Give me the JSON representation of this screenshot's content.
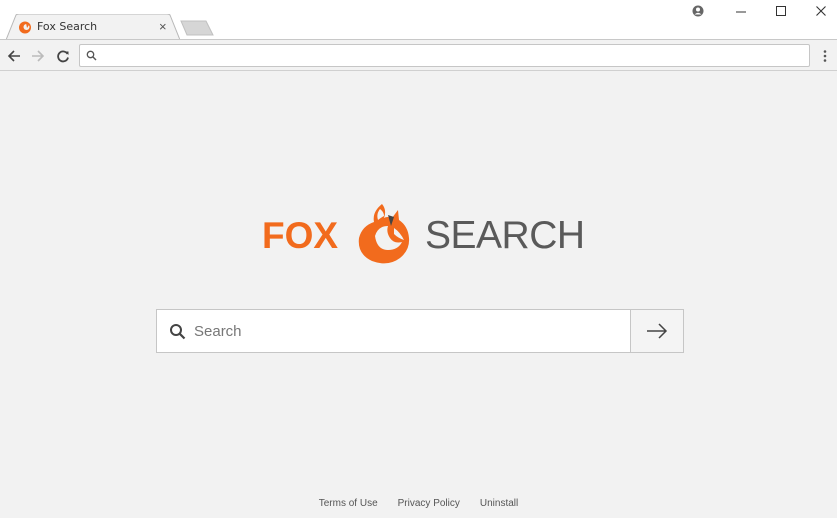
{
  "browser": {
    "tab": {
      "title": "Fox Search",
      "close_glyph": "×"
    },
    "omnibox": {
      "value": "",
      "placeholder": ""
    },
    "icons": [
      "back-arrow-icon",
      "forward-arrow-icon",
      "reload-icon",
      "search-icon",
      "menu-dots-icon",
      "account-icon",
      "minimize-icon",
      "maximize-icon",
      "close-icon"
    ]
  },
  "page": {
    "logo": {
      "word1": "FOX",
      "word2": "SEARCH"
    },
    "search": {
      "placeholder": "Search",
      "value": "",
      "submit_glyph": "→"
    },
    "footer": {
      "links": [
        "Terms of Use",
        "Privacy Policy",
        "Uninstall"
      ]
    },
    "colors": {
      "brand_orange": "#f26b1d",
      "text_gray": "#5a5a5a",
      "background": "#f2f2f2"
    }
  }
}
